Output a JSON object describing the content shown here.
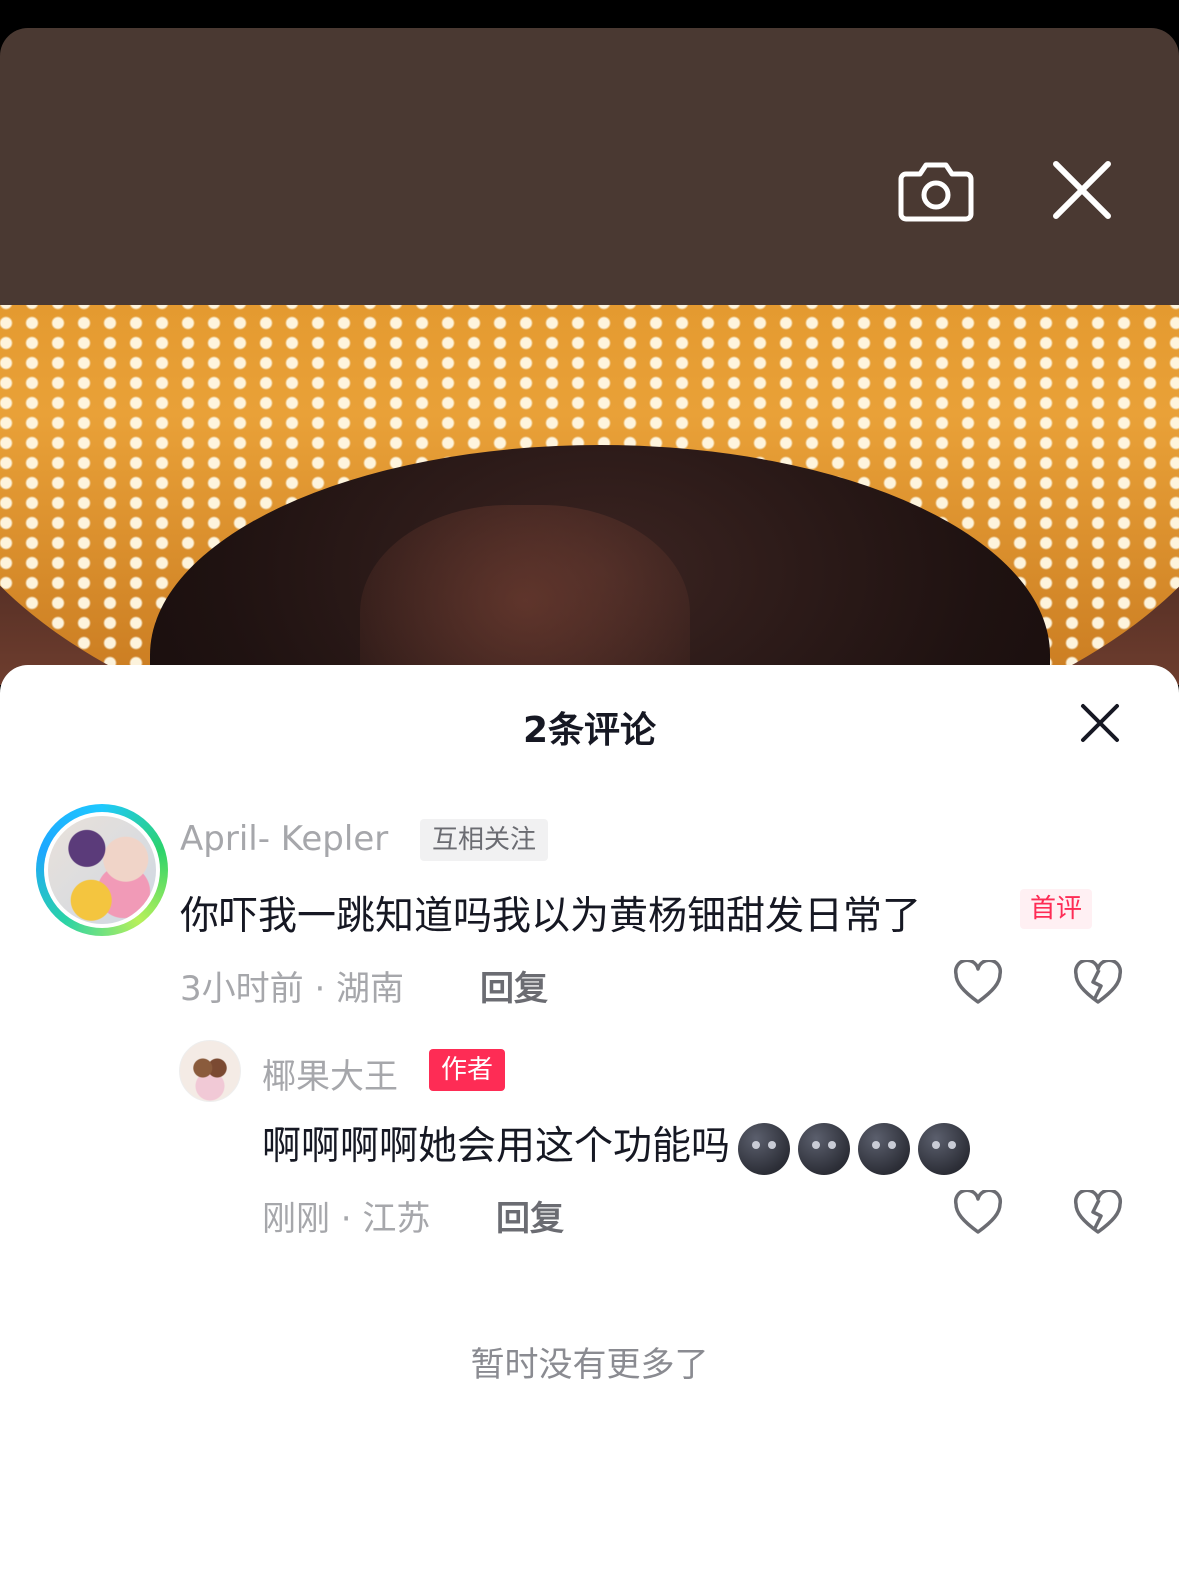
{
  "top_bar": {
    "camera_icon": "camera-icon",
    "close_icon": "close-icon"
  },
  "comments_panel": {
    "title": "2条评论",
    "close_icon": "close-icon",
    "comments": [
      {
        "username": "April- Kepler",
        "relation_tag": "互相关注",
        "text": "你吓我一跳知道吗我以为黄杨钿甜发日常了",
        "badge": "首评",
        "time_location": "3小时前 · 湖南",
        "reply_label": "回复"
      },
      {
        "username": "椰果大王",
        "author_tag": "作者",
        "text": "啊啊啊啊她会用这个功能吗",
        "emoji": [
          "new-moon-face-emoji",
          "new-moon-face-emoji",
          "new-moon-face-emoji",
          "new-moon-face-emoji"
        ],
        "time_location": "刚刚 · 江苏",
        "reply_label": "回复"
      }
    ],
    "empty_note": "暂时没有更多了"
  },
  "colors": {
    "top_sheet": "#4a3932",
    "accent": "#fe2c55",
    "text_primary": "#161823",
    "text_secondary": "#a6a7ab"
  }
}
